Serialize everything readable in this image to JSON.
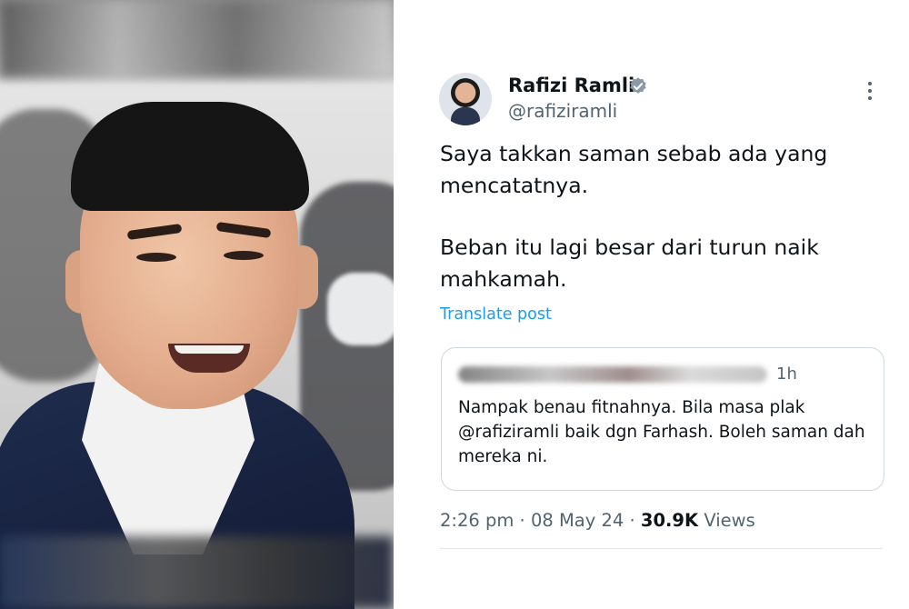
{
  "tweet": {
    "author_name": "Rafizi Ramli",
    "handle": "@rafiziramli",
    "text_lines": [
      "Saya takkan saman sebab ada yang mencatatnya.",
      "Beban itu lagi besar dari turun naik mahkamah."
    ],
    "translate_label": "Translate post",
    "quoted": {
      "time": "1h",
      "text": "Nampak benau fitnahnya. Bila masa plak @rafiziramli baik dgn Farhash. Boleh saman dah mereka ni."
    },
    "timestamp": "2:26 pm · 08 May 24 · ",
    "views_count": "30.9K",
    "views_label": "Views"
  },
  "colors": {
    "link": "#1d9bf0",
    "text": "#0f1419",
    "secondary": "#536471",
    "border": "#cfd9de"
  },
  "icons": {
    "verified": "verified-badge-icon",
    "more": "more-options-icon"
  }
}
